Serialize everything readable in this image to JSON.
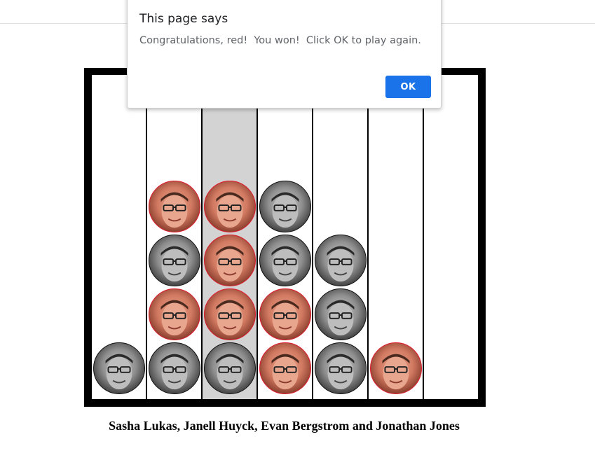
{
  "dialog": {
    "title": "This page says",
    "message": "Congratulations, red!  You won!  Click OK to play again.",
    "ok_label": "OK"
  },
  "board": {
    "columns": 7,
    "rows": 6,
    "highlighted_column": 3,
    "columns_pieces": [
      [
        "black"
      ],
      [
        "black",
        "red",
        "black",
        "red"
      ],
      [
        "black",
        "red",
        "red",
        "red"
      ],
      [
        "red",
        "red",
        "black",
        "black"
      ],
      [
        "black",
        "black",
        "black"
      ],
      [
        "red"
      ],
      []
    ],
    "colors": {
      "red_border": "#e0192c",
      "black_border": "#111111",
      "highlight": "#d3d3d3",
      "frame": "#000000"
    }
  },
  "credits": "Sasha Lukas, Janell Huyck, Evan Bergstrom and Jonathan Jones"
}
